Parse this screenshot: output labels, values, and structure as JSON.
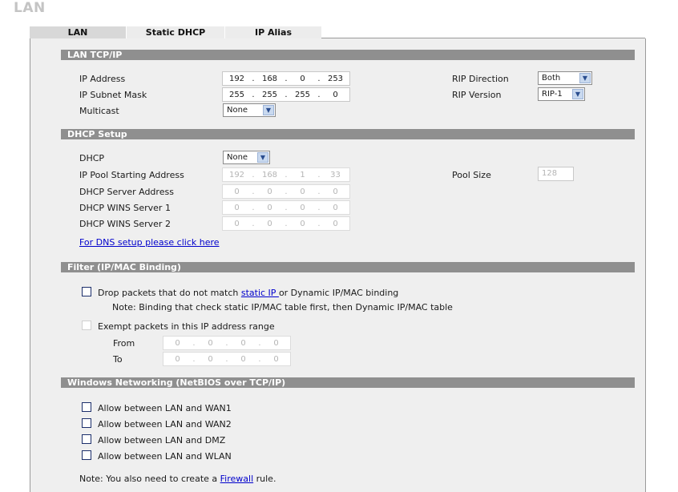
{
  "page": {
    "title": "LAN"
  },
  "tabs": [
    {
      "label": "LAN",
      "active": true
    },
    {
      "label": "Static DHCP"
    },
    {
      "label": "IP Alias"
    }
  ],
  "lan_tcpip": {
    "header": "LAN TCP/IP",
    "ip_address_label": "IP Address",
    "ip_address": [
      "192",
      "168",
      "0",
      "253"
    ],
    "subnet_label": "IP Subnet Mask",
    "subnet": [
      "255",
      "255",
      "255",
      "0"
    ],
    "multicast_label": "Multicast",
    "multicast_value": "None",
    "rip_direction_label": "RIP Direction",
    "rip_direction_value": "Both",
    "rip_version_label": "RIP Version",
    "rip_version_value": "RIP-1"
  },
  "dhcp": {
    "header": "DHCP Setup",
    "dhcp_label": "DHCP",
    "dhcp_value": "None",
    "pool_start_label": "IP Pool Starting Address",
    "pool_start": [
      "192",
      "168",
      "1",
      "33"
    ],
    "server_label": "DHCP Server Address",
    "server": [
      "0",
      "0",
      "0",
      "0"
    ],
    "wins1_label": "DHCP WINS Server 1",
    "wins1": [
      "0",
      "0",
      "0",
      "0"
    ],
    "wins2_label": "DHCP WINS Server 2",
    "wins2": [
      "0",
      "0",
      "0",
      "0"
    ],
    "pool_size_label": "Pool Size",
    "pool_size": "128",
    "dns_link": "For DNS setup please click here"
  },
  "filter": {
    "header": "Filter (IP/MAC Binding)",
    "drop_text_pre": "Drop packets that do not match ",
    "drop_link": "static IP ",
    "drop_text_post": "or Dynamic IP/MAC binding",
    "note": "Note: Binding that check static IP/MAC table first, then Dynamic IP/MAC table",
    "exempt_label": "Exempt packets in this IP address range",
    "from_label": "From",
    "from": [
      "0",
      "0",
      "0",
      "0"
    ],
    "to_label": "To",
    "to": [
      "0",
      "0",
      "0",
      "0"
    ]
  },
  "netbios": {
    "header": "Windows Networking (NetBIOS over TCP/IP)",
    "options": [
      "Allow between LAN and WAN1",
      "Allow between LAN and WAN2",
      "Allow between LAN and DMZ",
      "Allow between LAN and WLAN"
    ],
    "note_pre": "Note: You also need to create a ",
    "note_link": "Firewall",
    "note_post": " rule."
  }
}
